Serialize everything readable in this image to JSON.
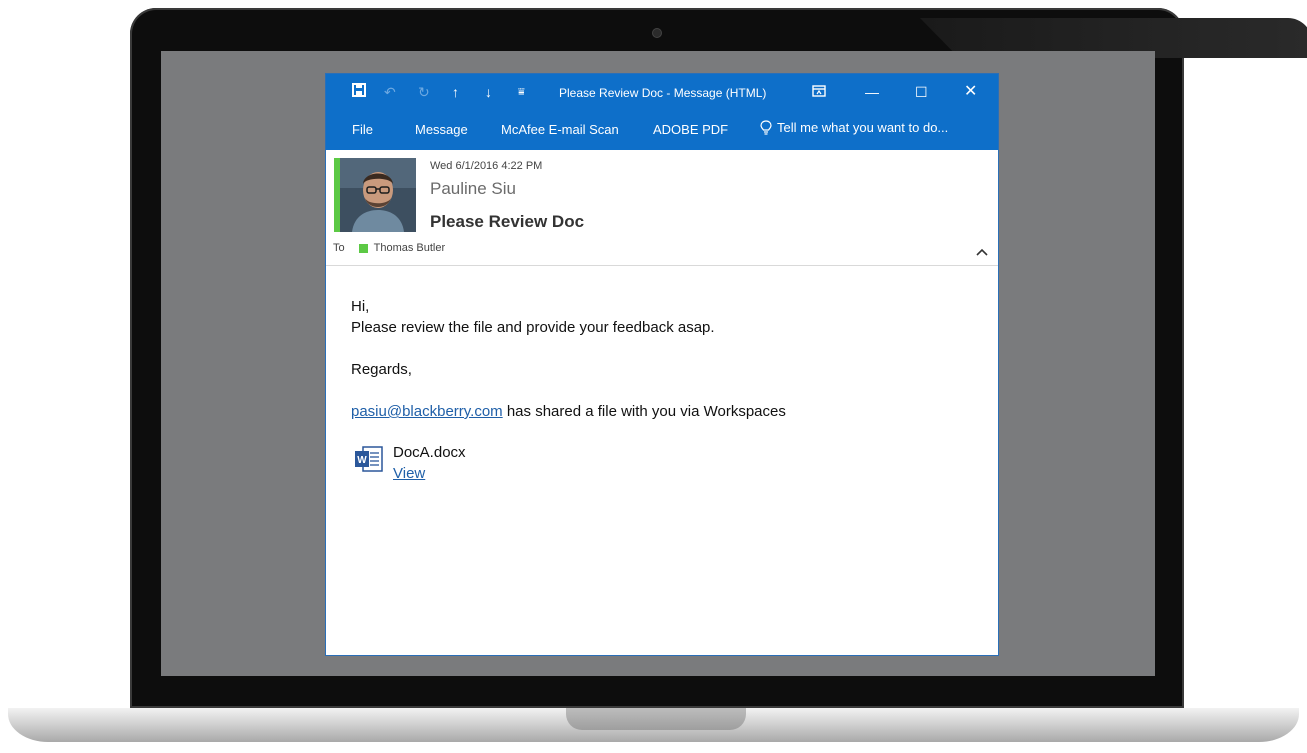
{
  "window": {
    "title": "Please Review Doc - Message (HTML)",
    "qat": {
      "save_icon": "save-icon",
      "undo_icon": "undo-icon",
      "redo_icon": "redo-icon",
      "up_icon": "arrow-up-icon",
      "down_icon": "arrow-down-icon",
      "more_icon": "customize-qat-icon"
    },
    "controls": {
      "ribbon_display": "ribbon-display-icon",
      "minimize": "minimize-icon",
      "maximize": "maximize-icon",
      "close": "close-icon"
    }
  },
  "ribbon": {
    "tabs": [
      "File",
      "Message",
      "McAfee E-mail Scan",
      "ADOBE PDF"
    ],
    "tellme": "Tell me what you want to do..."
  },
  "message": {
    "date": "Wed 6/1/2016 4:22 PM",
    "sender": "Pauline Siu",
    "subject": "Please Review Doc",
    "to_label": "To",
    "recipient": "Thomas Butler",
    "body": {
      "greeting": "Hi,",
      "line1": "Please review the file and provide your feedback asap.",
      "regards": "Regards,",
      "share_link": "pasiu@blackberry.com",
      "share_text": " has shared a file with you via Workspaces"
    },
    "attachment": {
      "name": "DocA.docx",
      "action": "View",
      "icon": "word-icon"
    }
  },
  "colors": {
    "accent": "#0e6fc9",
    "presence": "#5cc945",
    "link": "#1f5fa8"
  }
}
